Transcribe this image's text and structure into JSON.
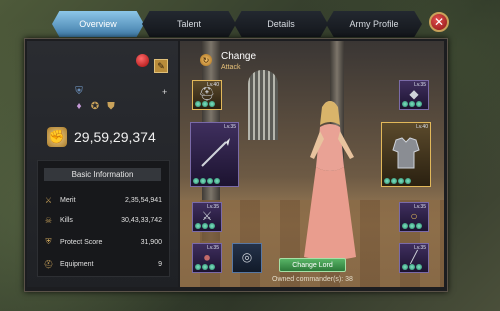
{
  "tabs": [
    {
      "label": "Overview",
      "active": true
    },
    {
      "label": "Talent",
      "active": false
    },
    {
      "label": "Details",
      "active": false
    },
    {
      "label": "Army Profile",
      "active": false
    }
  ],
  "close_icon": "close-icon",
  "profile": {
    "power_value": "29,59,29,374",
    "power_icon": "fist-icon",
    "edit_icon": "pencil-icon",
    "gem_icon": "red-gem-icon"
  },
  "info": {
    "title": "Basic Information",
    "rows": [
      {
        "icon": "sword-icon",
        "label": "Merit",
        "value": "2,35,54,941"
      },
      {
        "icon": "skull-icon",
        "label": "Kills",
        "value": "30,43,33,742"
      },
      {
        "icon": "shield-icon",
        "label": "Protect Score",
        "value": "31,900"
      },
      {
        "icon": "helmet-icon",
        "label": "Equipment",
        "value": "9"
      }
    ]
  },
  "commander": {
    "change_title": "Change",
    "change_subtitle": "Attack",
    "change_lord_label": "Change Lord",
    "owned_text": "Owned commander(s): 38"
  },
  "equipment": [
    {
      "name": "helmet",
      "level": "Lv.40"
    },
    {
      "name": "spear",
      "level": "Lv.35"
    },
    {
      "name": "boots",
      "level": "Lv.35"
    },
    {
      "name": "orb",
      "level": "Lv.35"
    },
    {
      "name": "shoulder-piece",
      "level": "Lv.35"
    },
    {
      "name": "armor",
      "level": "Lv.40"
    },
    {
      "name": "ring",
      "level": "Lv.35"
    },
    {
      "name": "bracer",
      "level": "Lv.35"
    }
  ],
  "colors": {
    "active_tab": "#5fa3d3",
    "close_button": "#c62828",
    "change_lord_button": "#3f9a4f",
    "gold_accent": "#c9a25a"
  }
}
